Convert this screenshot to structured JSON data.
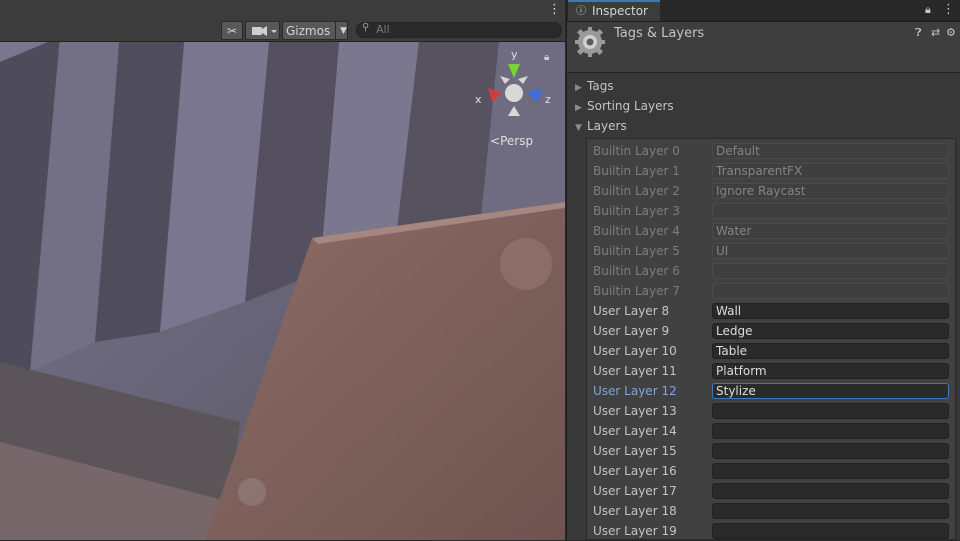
{
  "scene": {
    "gizmos_label": "Gizmos",
    "search_placeholder": "All",
    "axis_x": "x",
    "axis_y": "y",
    "axis_z": "z",
    "persp_label": "Persp"
  },
  "inspector": {
    "tab_label": "Inspector",
    "title": "Tags & Layers",
    "sections": {
      "tags": "Tags",
      "sorting_layers": "Sorting Layers",
      "layers": "Layers"
    },
    "layers": [
      {
        "label": "Builtin Layer 0",
        "value": "Default",
        "kind": "builtin"
      },
      {
        "label": "Builtin Layer 1",
        "value": "TransparentFX",
        "kind": "builtin"
      },
      {
        "label": "Builtin Layer 2",
        "value": "Ignore Raycast",
        "kind": "builtin"
      },
      {
        "label": "Builtin Layer 3",
        "value": "",
        "kind": "builtin"
      },
      {
        "label": "Builtin Layer 4",
        "value": "Water",
        "kind": "builtin"
      },
      {
        "label": "Builtin Layer 5",
        "value": "UI",
        "kind": "builtin"
      },
      {
        "label": "Builtin Layer 6",
        "value": "",
        "kind": "builtin"
      },
      {
        "label": "Builtin Layer 7",
        "value": "",
        "kind": "builtin"
      },
      {
        "label": "User Layer 8",
        "value": "Wall",
        "kind": "user"
      },
      {
        "label": "User Layer 9",
        "value": "Ledge",
        "kind": "user"
      },
      {
        "label": "User Layer 10",
        "value": "Table",
        "kind": "user"
      },
      {
        "label": "User Layer 11",
        "value": "Platform",
        "kind": "user"
      },
      {
        "label": "User Layer 12",
        "value": "Stylize",
        "kind": "user",
        "selected": true
      },
      {
        "label": "User Layer 13",
        "value": "",
        "kind": "user"
      },
      {
        "label": "User Layer 14",
        "value": "",
        "kind": "user"
      },
      {
        "label": "User Layer 15",
        "value": "",
        "kind": "user"
      },
      {
        "label": "User Layer 16",
        "value": "",
        "kind": "user"
      },
      {
        "label": "User Layer 17",
        "value": "",
        "kind": "user"
      },
      {
        "label": "User Layer 18",
        "value": "",
        "kind": "user"
      },
      {
        "label": "User Layer 19",
        "value": "",
        "kind": "user"
      }
    ]
  },
  "colors": {
    "accent": "#3a79bb",
    "axis_x": "#d23b3b",
    "axis_y": "#7ad13a",
    "axis_z": "#3b6fdb"
  },
  "icons": [
    "more-vert-icon",
    "tools-icon",
    "camera-icon",
    "dropdown-arrow-icon",
    "search-icon",
    "info-icon",
    "lock-icon",
    "gear-icon",
    "help-icon",
    "presets-icon",
    "settings-icon",
    "fold-arrow-icon"
  ]
}
